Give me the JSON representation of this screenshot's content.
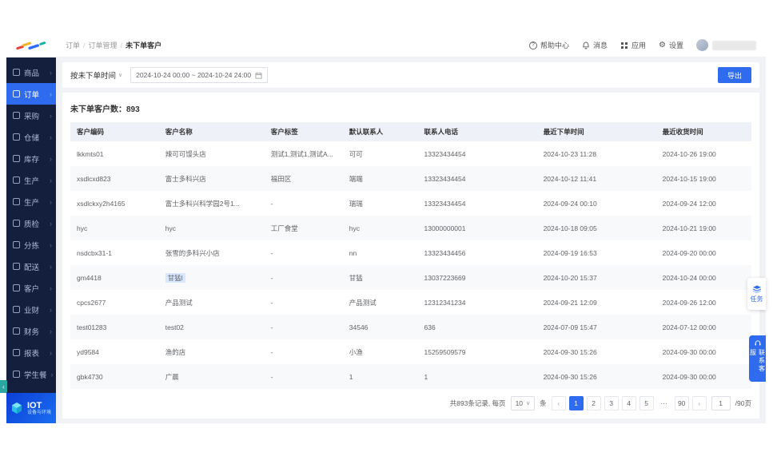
{
  "colors": {
    "accent": "#2e6bef",
    "sidebar_bg": "#141f3d",
    "table_header_bg": "#eef1f7"
  },
  "topbar": {
    "breadcrumb": [
      "订单",
      "订单管理",
      "未下单客户"
    ],
    "help_label": "帮助中心",
    "messages_label": "消息",
    "apps_label": "应用",
    "settings_label": "设置"
  },
  "sidebar": {
    "items": [
      {
        "label": "商品",
        "icon": "goods-icon",
        "active": false
      },
      {
        "label": "订单",
        "icon": "orders-icon",
        "active": true
      },
      {
        "label": "采购",
        "icon": "purchase-icon",
        "active": false
      },
      {
        "label": "仓储",
        "icon": "warehouse-icon",
        "active": false
      },
      {
        "label": "库存",
        "icon": "inventory-icon",
        "active": false
      },
      {
        "label": "生产",
        "icon": "production-icon",
        "active": false
      },
      {
        "label": "生产",
        "icon": "production2-icon",
        "active": false
      },
      {
        "label": "质检",
        "icon": "quality-check-icon",
        "active": false
      },
      {
        "label": "分拣",
        "icon": "sorting-icon",
        "active": false
      },
      {
        "label": "配送",
        "icon": "delivery-icon",
        "active": false
      },
      {
        "label": "客户",
        "icon": "customers-icon",
        "active": false
      },
      {
        "label": "业财",
        "icon": "biz-finance-icon",
        "active": false
      },
      {
        "label": "财务",
        "icon": "finance-icon",
        "active": false
      },
      {
        "label": "报表",
        "icon": "reports-icon",
        "active": false
      },
      {
        "label": "学生餐",
        "icon": "student-meal-icon",
        "active": false
      }
    ],
    "iot": {
      "title": "IOT",
      "subtitle": "设备与环境"
    }
  },
  "page": {
    "filter_label": "按未下单时间",
    "date_range": "2024-10-24 00:00 ~ 2024-10-24 24:00",
    "export_label": "导出",
    "summary": "未下单客户数：893"
  },
  "table": {
    "headers": [
      "客户编码",
      "客户名称",
      "客户标签",
      "默认联系人",
      "联系人电话",
      "最近下单时间",
      "最近收货时间"
    ],
    "rows": [
      {
        "cells": [
          "lkkmts01",
          "辣可可馒头店",
          "测试1,测试1,测试A...",
          "可可",
          "13323434454",
          "2024-10-23 11:28",
          "2024-10-26 19:00"
        ]
      },
      {
        "cells": [
          "xsdlcxd823",
          "富士多科兴店",
          "福田区",
          "端端",
          "13323434454",
          "2024-10-12 11:41",
          "2024-10-15 19:00"
        ]
      },
      {
        "cells": [
          "xsdlckxy2h4165",
          "富士多科兴科学园2号1...",
          "-",
          "瑞瑞",
          "13323434454",
          "2024-09-24 00:10",
          "2024-09-24 12:00"
        ]
      },
      {
        "cells": [
          "hyc",
          "hyc",
          "工厂食堂",
          "hyc",
          "13000000001",
          "2024-10-18 09:05",
          "2024-10-21 19:00"
        ]
      },
      {
        "cells": [
          "nsdcbx31-1",
          "张雪的多科兴小店",
          "-",
          "nn",
          "13323434456",
          "2024-09-19 16:53",
          "2024-09-20 00:00"
        ]
      },
      {
        "cells": [
          "gm4418",
          "甘猛l",
          "-",
          "甘猛",
          "13037223669",
          "2024-10-20 15:37",
          "2024-10-24 00:00"
        ],
        "highlight_cell": 1
      },
      {
        "cells": [
          "cpcs2677",
          "产品测试",
          "-",
          "产品测试",
          "12312341234",
          "2024-09-21 12:09",
          "2024-09-26 12:00"
        ]
      },
      {
        "cells": [
          "test01283",
          "test02",
          "-",
          "34546",
          "636",
          "2024-07-09 15:47",
          "2024-07-12 00:00"
        ]
      },
      {
        "cells": [
          "yd9584",
          "渔的店",
          "-",
          "小渔",
          "15259509579",
          "2024-09-30 15:26",
          "2024-09-30 00:00"
        ]
      },
      {
        "cells": [
          "gbk4730",
          "广晨",
          "-",
          "1",
          "1",
          "2024-09-30 15:26",
          "2024-09-30 00:00"
        ]
      }
    ]
  },
  "pagination": {
    "total_prefix": "共893条记录, 每页",
    "page_size": "10",
    "unit": "条",
    "prev": "‹",
    "next": "›",
    "pages": [
      "1",
      "2",
      "3",
      "4",
      "5",
      "···",
      "90"
    ],
    "active_page": "1",
    "jump_value": "1",
    "jump_suffix": "/90页"
  },
  "floating": {
    "task_label": "任务",
    "support_label": "联系客服"
  }
}
